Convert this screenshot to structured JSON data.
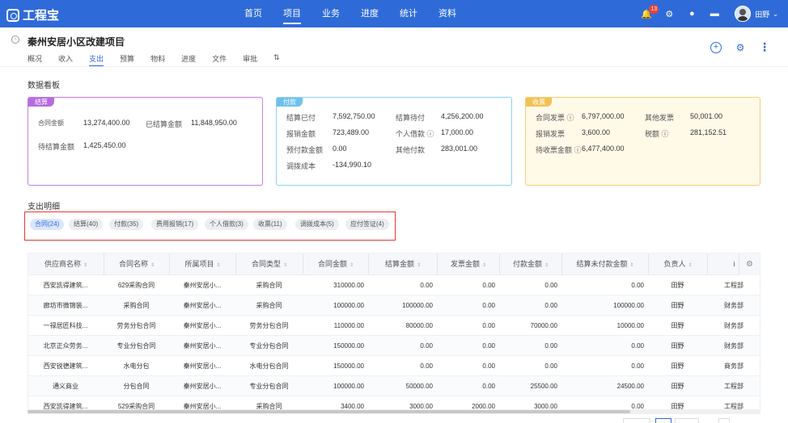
{
  "app": {
    "logo": "工程宝"
  },
  "nav": {
    "items": [
      "首页",
      "项目",
      "业务",
      "进度",
      "统计",
      "资料"
    ],
    "active": 1,
    "notification_count": "13",
    "user_name": "田野"
  },
  "project": {
    "title": "秦州安居小区改建项目",
    "tabs": [
      "概况",
      "收入",
      "支出",
      "预算",
      "物料",
      "进度",
      "文件",
      "审批",
      "⇅"
    ],
    "active_tab": 2
  },
  "dashboard": {
    "title": "数据看板",
    "settlement": {
      "tag": "结算",
      "contract_amount_label": "合同金额",
      "contract_amount": "13,274,400.00",
      "settled_label": "已结算金额",
      "settled": "11,848,950.00",
      "pending_label": "待结算金额",
      "pending": "1,425,450.00"
    },
    "payment": {
      "tag": "付款",
      "rows": [
        {
          "l1": "结算已付",
          "v1": "7,592,750.00",
          "l2": "结算待付",
          "v2": "4,256,200.00"
        },
        {
          "l1": "报销金额",
          "v1": "723,489.00",
          "l2": "个人借款 ⓘ",
          "v2": "17,000.00"
        },
        {
          "l1": "预付款金额",
          "v1": "0.00",
          "l2": "其他付款",
          "v2": "283,001.00"
        },
        {
          "l1": "调拨成本",
          "v1": "-134,990.10",
          "l2": "",
          "v2": ""
        }
      ]
    },
    "invoice": {
      "tag": "收票",
      "rows": [
        {
          "l1": "合同发票 ⓘ",
          "v1": "6,797,000.00",
          "l2": "其他发票",
          "v2": "50,001.00"
        },
        {
          "l1": "报销发票",
          "v1": "3,600.00",
          "l2": "税额 ⓘ",
          "v2": "281,152.51"
        },
        {
          "l1": "待收票金额 ⓘ",
          "v1": "6,477,400.00",
          "l2": "",
          "v2": ""
        }
      ]
    }
  },
  "detail": {
    "title": "支出明细",
    "chips": [
      "合同(24)",
      "结算(40)",
      "付款(35)",
      "费用报销(17)",
      "个人借款(3)",
      "收票(11)",
      "调拨成本(5)",
      "应付签证(4)"
    ],
    "active_chip": 0
  },
  "table": {
    "headers": [
      "供应商名称",
      "合同名称",
      "所属项目",
      "合同类型",
      "合同金额",
      "结算金额",
      "发票金额",
      "付款金额",
      "结算未付款金额",
      "负责人",
      "i"
    ],
    "rows": [
      [
        "西安凯得建筑...",
        "629采购合同",
        "秦州安居小...",
        "采购合同",
        "310000.00",
        "0.00",
        "0.00",
        "0.00",
        "0.00",
        "田野",
        "工程部"
      ],
      [
        "廊坊市微锦装...",
        "采购合同",
        "秦州安居小...",
        "采购合同",
        "100000.00",
        "100000.00",
        "0.00",
        "0.00",
        "100000.00",
        "田野",
        "财务部"
      ],
      [
        "一禄居匠科技...",
        "劳务分包合同",
        "秦州安居小...",
        "劳务分包合同",
        "110000.00",
        "80000.00",
        "0.00",
        "70000.00",
        "10000.00",
        "田野",
        "财务部"
      ],
      [
        "北京正众劳务...",
        "专业分包合同",
        "秦州安居小...",
        "专业分包合同",
        "150000.00",
        "0.00",
        "0.00",
        "0.00",
        "0.00",
        "田野",
        "财务部"
      ],
      [
        "西安锐德建筑...",
        "水电分包",
        "秦州安居小...",
        "水电分包合同",
        "150000.00",
        "0.00",
        "0.00",
        "0.00",
        "0.00",
        "田野",
        "商务部"
      ],
      [
        "通义商业",
        "分包合同",
        "秦州安居小...",
        "专业分包合同",
        "100000.00",
        "50000.00",
        "0.00",
        "25500.00",
        "24500.00",
        "田野",
        "工程部"
      ],
      [
        "西安凯得建筑...",
        "529采购合同",
        "秦州安居小...",
        "采购合同",
        "3400.00",
        "3000.00",
        "2000.00",
        "3000.00",
        "0.00",
        "田野",
        "工程部"
      ]
    ]
  }
}
